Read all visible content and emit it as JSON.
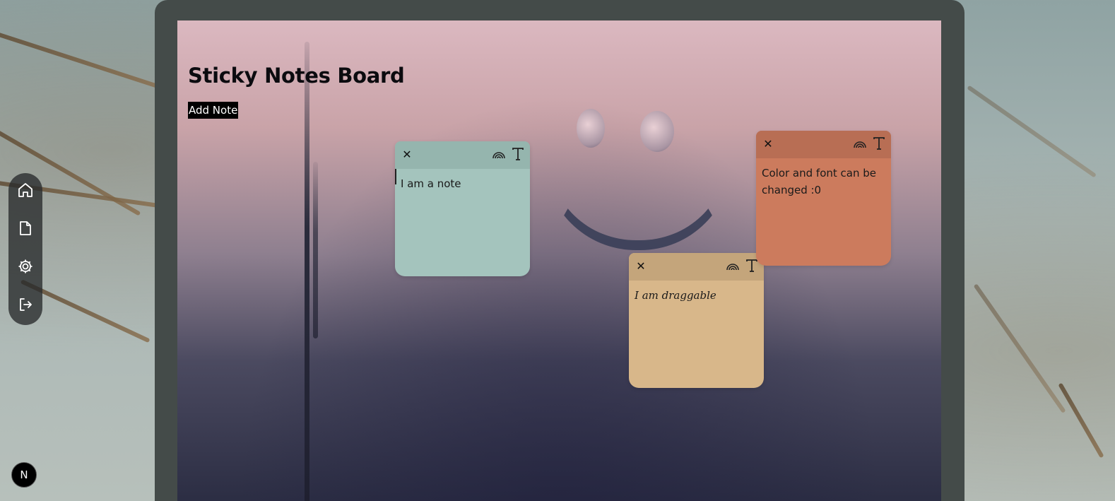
{
  "app": {
    "title": "Sticky Notes Board",
    "add_note_label": "Add Note"
  },
  "sidebar": {
    "items": [
      {
        "name": "home",
        "icon": "home-icon"
      },
      {
        "name": "notes",
        "icon": "file-icon"
      },
      {
        "name": "settings",
        "icon": "gear-icon"
      },
      {
        "name": "logout",
        "icon": "logout-icon"
      }
    ]
  },
  "badge": {
    "letter": "N"
  },
  "notes": [
    {
      "text": "I am a note",
      "color_body": "#a4c4bd",
      "color_header": "#95b5ae",
      "font": "sans"
    },
    {
      "text": "I am draggable",
      "color_body": "#d8b78a",
      "color_header": "#c4a57b",
      "font": "script"
    },
    {
      "text": "Color and font can be changed :0",
      "color_body": "#cc7b5d",
      "color_header": "#b86e54",
      "font": "sans"
    }
  ],
  "note_controls": {
    "close_symbol": "✕",
    "color_icon": "rainbow-icon",
    "font_icon": "text-icon"
  }
}
